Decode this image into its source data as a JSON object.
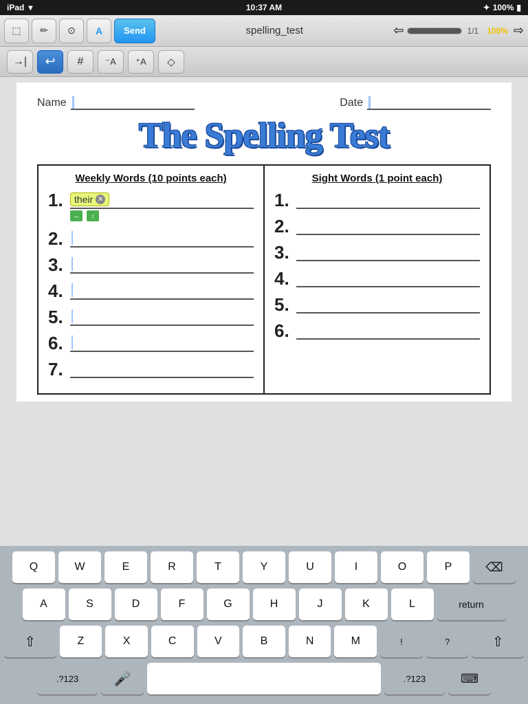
{
  "statusBar": {
    "left": "iPad",
    "time": "10:37 AM",
    "battery": "100%"
  },
  "toolbar": {
    "sendLabel": "Send",
    "documentTitle": "spelling_test",
    "page": "1/1",
    "zoom": "100%"
  },
  "secondaryToolbar": {
    "buttons": [
      "→|",
      "↩",
      "#",
      "-A",
      "+A",
      "◇"
    ]
  },
  "document": {
    "nameLabel": "Name",
    "dateLabel": "Date",
    "title": "The Spelling Test",
    "weeklyHeader": "Weekly Words (10 points each)",
    "sightHeader": "Sight Words (1 point each)",
    "weeklyNums": [
      "1.",
      "2.",
      "3.",
      "4.",
      "5.",
      "6.",
      "7."
    ],
    "sightNums": [
      "1.",
      "2.",
      "3.",
      "4.",
      "5.",
      "6."
    ],
    "enteredWord": "their"
  },
  "keyboard": {
    "row1": [
      "Q",
      "W",
      "E",
      "R",
      "T",
      "Y",
      "U",
      "I",
      "O",
      "P"
    ],
    "row2": [
      "A",
      "S",
      "D",
      "F",
      "G",
      "H",
      "J",
      "K",
      "L"
    ],
    "row3": [
      "Z",
      "X",
      "C",
      "V",
      "B",
      "N",
      "M"
    ],
    "returnLabel": "return",
    "numbersLabel": ".?123",
    "spaceLabel": ""
  }
}
